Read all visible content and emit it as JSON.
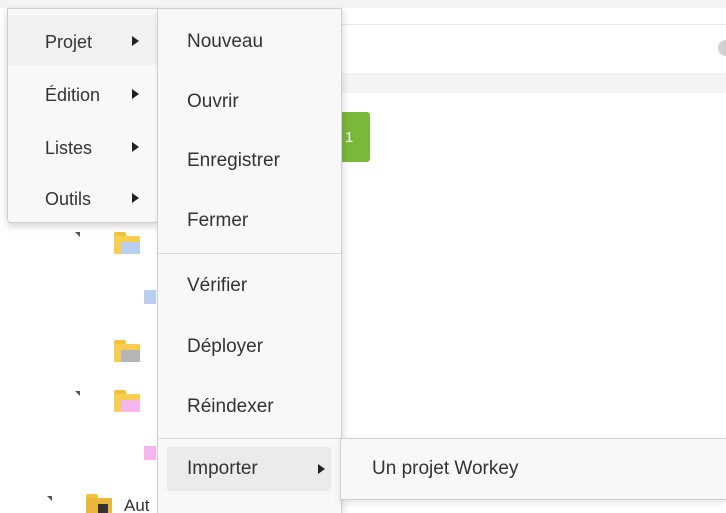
{
  "main_menu": {
    "items": [
      {
        "label": "Projet"
      },
      {
        "label": "Édition"
      },
      {
        "label": "Listes"
      },
      {
        "label": "Outils"
      }
    ]
  },
  "project_submenu": {
    "items": [
      {
        "label": "Nouveau"
      },
      {
        "label": "Ouvrir"
      },
      {
        "label": "Enregistrer"
      },
      {
        "label": "Fermer"
      },
      {
        "label": "Vérifier"
      },
      {
        "label": "Déployer"
      },
      {
        "label": "Réindexer"
      },
      {
        "label": "Importer"
      }
    ]
  },
  "import_submenu": {
    "items": [
      {
        "label": "Un projet Workey"
      }
    ]
  },
  "background": {
    "badge_text": "1",
    "tree_partial_label": "Aut"
  },
  "colors": {
    "badge": "#7ab83a",
    "folder": "#f7ce4f",
    "folder_label_blue": "#b8cdf0",
    "folder_label_gray": "#b5b5b5",
    "folder_label_pink": "#f4b6ec",
    "menu_background": "#f8f8f8"
  },
  "icons": {
    "submenu_arrow": "triangle-right-icon",
    "tree_toggle": "tree-expanded-icon",
    "folder": "folder-icon"
  }
}
